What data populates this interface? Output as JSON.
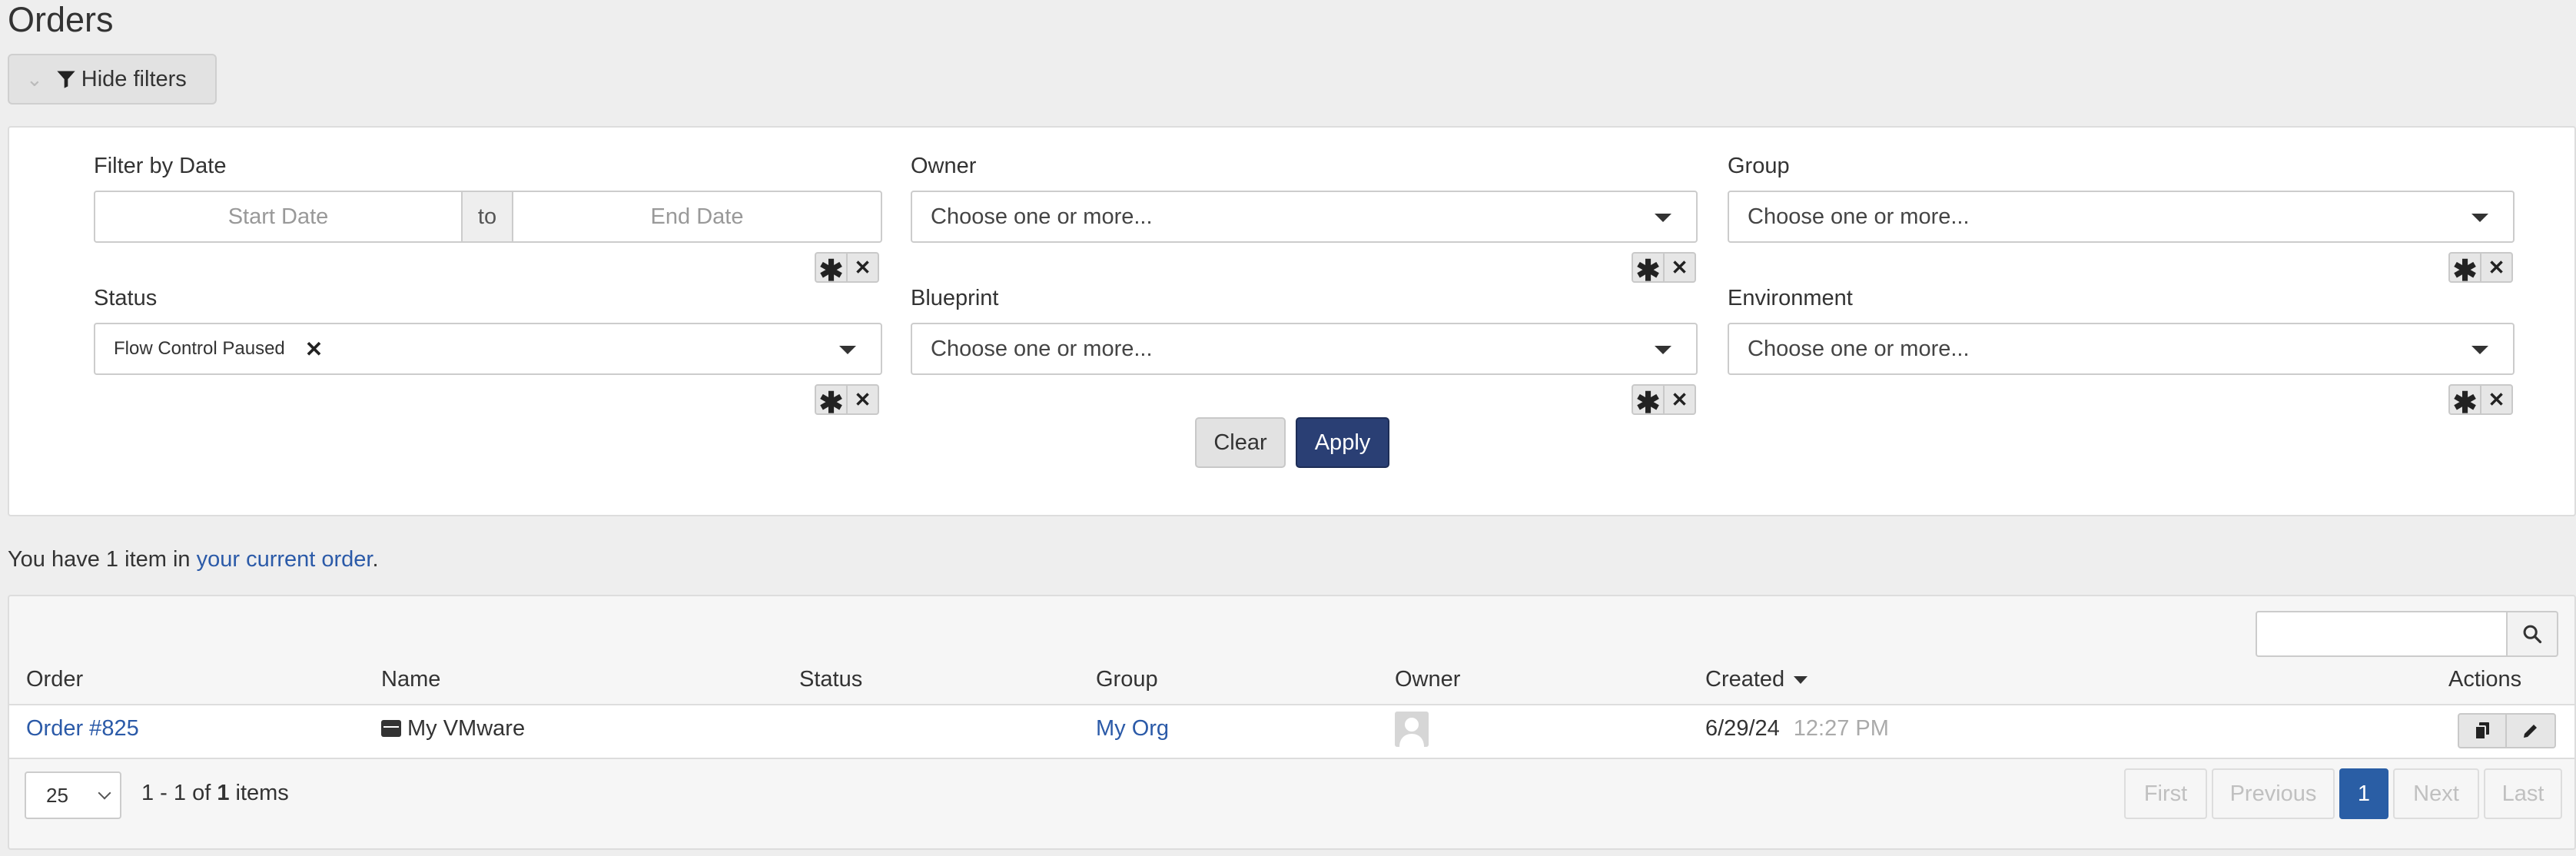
{
  "page": {
    "title": "Orders"
  },
  "toolbar": {
    "toggle_filters_label": "Hide filters"
  },
  "filters": {
    "date": {
      "label": "Filter by Date",
      "start_placeholder": "Start Date",
      "to_label": "to",
      "end_placeholder": "End Date"
    },
    "owner": {
      "label": "Owner",
      "placeholder": "Choose one or more..."
    },
    "group": {
      "label": "Group",
      "placeholder": "Choose one or more..."
    },
    "status": {
      "label": "Status",
      "selected": [
        "Flow Control Paused"
      ]
    },
    "blueprint": {
      "label": "Blueprint",
      "placeholder": "Choose one or more..."
    },
    "environment": {
      "label": "Environment",
      "placeholder": "Choose one or more..."
    },
    "all_symbol": "✱",
    "clear_symbol": "✕",
    "chip_remove_symbol": "✕",
    "clear_label": "Clear",
    "apply_label": "Apply"
  },
  "notice": {
    "prefix": "You have 1 item in ",
    "link": "your current order",
    "suffix": "."
  },
  "table": {
    "columns": [
      "Order",
      "Name",
      "Status",
      "Group",
      "Owner",
      "Created",
      "Actions"
    ],
    "sort_column": "Created",
    "rows": [
      {
        "order": "Order #825",
        "name": "My VMware",
        "status": "",
        "group": "My Org",
        "created_date": "6/29/24",
        "created_time": "12:27 PM"
      }
    ],
    "page_size": "25",
    "info": {
      "range": "1 - 1 of ",
      "total": "1",
      "unit": " items"
    },
    "pager": {
      "first": "First",
      "previous": "Previous",
      "current": "1",
      "next": "Next",
      "last": "Last"
    }
  },
  "colors": {
    "primary": "#2a3f74",
    "link": "#2b5aa8",
    "active_page": "#2a5ea5",
    "background": "#eeeeee"
  },
  "icons": [
    "chevron-down-icon",
    "filter-icon",
    "search-icon",
    "vm-icon",
    "avatar-icon",
    "copy-icon",
    "pencil-icon"
  ]
}
